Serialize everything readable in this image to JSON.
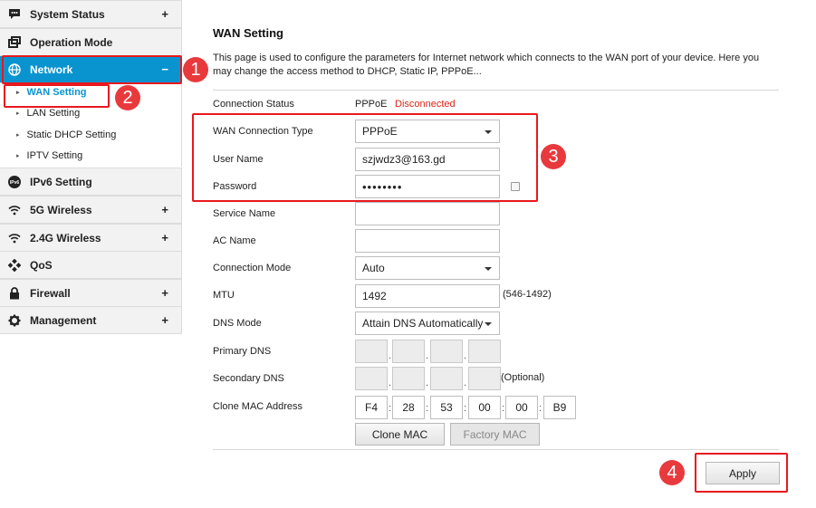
{
  "sidebar": {
    "items": [
      {
        "label": "System Status",
        "icon": "chat-icon",
        "expand": "+"
      },
      {
        "label": "Operation Mode",
        "icon": "windows-icon",
        "expand": ""
      },
      {
        "label": "Network",
        "icon": "globe-icon",
        "expand": "−"
      },
      {
        "label": "IPv6 Setting",
        "icon": "ipv6-icon",
        "expand": ""
      },
      {
        "label": "5G Wireless",
        "icon": "wifi-icon",
        "expand": "+"
      },
      {
        "label": "2.4G Wireless",
        "icon": "wifi-icon",
        "expand": "+"
      },
      {
        "label": "QoS",
        "icon": "qos-icon",
        "expand": ""
      },
      {
        "label": "Firewall",
        "icon": "lock-icon",
        "expand": "+"
      },
      {
        "label": "Management",
        "icon": "gear-icon",
        "expand": "+"
      }
    ],
    "network_sub": [
      "WAN Setting",
      "LAN Setting",
      "Static DHCP Setting",
      "IPTV Setting"
    ]
  },
  "main": {
    "title": "WAN Setting",
    "description": "This page is used to configure the parameters for Internet network which connects to the WAN port of your device. Here you may change the access method to DHCP, Static IP, PPPoE...",
    "connection_status": {
      "label": "Connection Status",
      "type": "PPPoE",
      "state": "Disconnected"
    },
    "wan_connection_type": {
      "label": "WAN Connection Type",
      "value": "PPPoE"
    },
    "user_name": {
      "label": "User Name",
      "value": "szjwdz3@163.gd"
    },
    "password": {
      "label": "Password",
      "value": "••••••••"
    },
    "service_name": {
      "label": "Service Name",
      "value": ""
    },
    "ac_name": {
      "label": "AC Name",
      "value": ""
    },
    "connection_mode": {
      "label": "Connection Mode",
      "value": "Auto"
    },
    "mtu": {
      "label": "MTU",
      "value": "1492",
      "hint": "(546-1492)"
    },
    "dns_mode": {
      "label": "DNS Mode",
      "value": "Attain DNS Automatically"
    },
    "primary_dns": {
      "label": "Primary DNS"
    },
    "secondary_dns": {
      "label": "Secondary DNS",
      "hint": "(Optional)"
    },
    "clone_mac": {
      "label": "Clone MAC Address",
      "octets": [
        "F4",
        "28",
        "53",
        "00",
        "00",
        "B9"
      ]
    },
    "clone_mac_button": "Clone MAC",
    "factory_mac_button": "Factory MAC",
    "apply_button": "Apply"
  },
  "annotations": {
    "badges": [
      "1",
      "2",
      "3",
      "4"
    ],
    "color": "#e8191e"
  },
  "colors": {
    "accent": "#0a94cf",
    "status_red": "#d9261c",
    "highlight": "#e8191e"
  }
}
